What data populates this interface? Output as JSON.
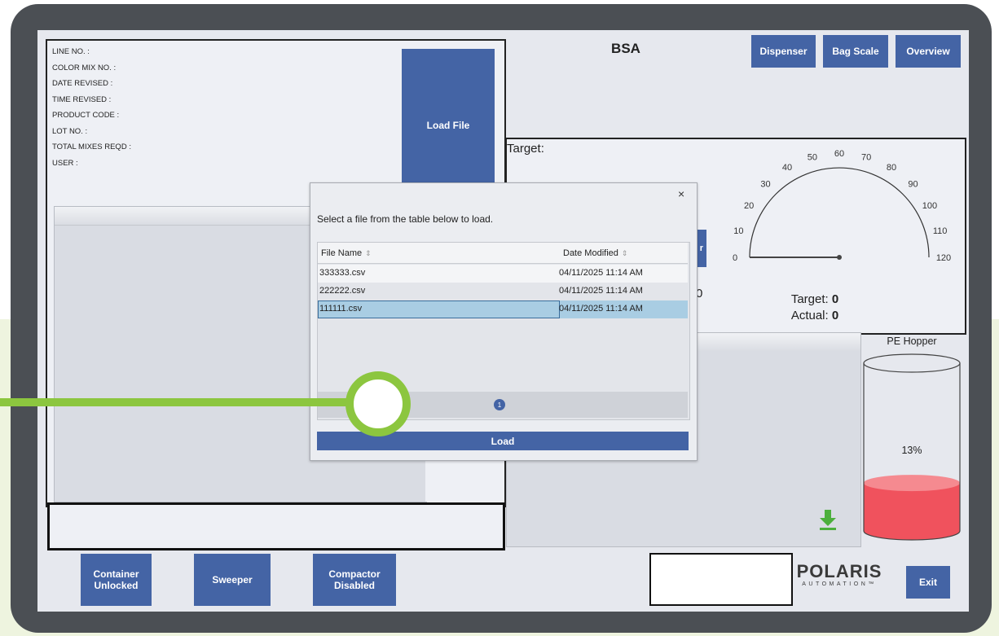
{
  "header": {
    "title": "BSA",
    "nav_buttons": [
      "Dispenser",
      "Bag Scale",
      "Overview"
    ]
  },
  "info_fields": [
    "LINE NO. :",
    "COLOR MIX NO. :",
    "DATE REVISED :",
    "TIME REVISED :",
    "PRODUCT CODE :",
    "LOT NO. :",
    "TOTAL MIXES REQD :",
    "USER :"
  ],
  "load_file_label": "Load File",
  "scale": {
    "target_label": "Target:",
    "gauge_ticks": [
      "0",
      "10",
      "20",
      "30",
      "40",
      "50",
      "60",
      "70",
      "80",
      "90",
      "100",
      "110",
      "120"
    ],
    "gauge_value": 0,
    "gauge_max": 120,
    "readout_target_label": "Target:",
    "readout_target_value": "0",
    "readout_actual_label": "Actual:",
    "readout_actual_value": "0",
    "partial_button_text": "r",
    "partial_value_text": "0"
  },
  "hopper": {
    "label": "PE Hopper",
    "percent_text": "13%",
    "fill_fraction": 0.13,
    "fill_color": "#f0525d"
  },
  "dialog": {
    "close_symbol": "×",
    "message": "Select a file from the table below to load.",
    "columns": [
      "File Name",
      "Date Modified"
    ],
    "rows": [
      {
        "file": "333333.csv",
        "date": "04/11/2025 11:14 AM"
      },
      {
        "file": "222222.csv",
        "date": "04/11/2025 11:14 AM"
      },
      {
        "file": "111111.csv",
        "date": "04/11/2025 11:14 AM"
      }
    ],
    "selected_row": 2,
    "page_number": "1",
    "load_label": "Load"
  },
  "bottom_buttons": [
    "Container\nUnlocked",
    "Sweeper",
    "Compactor\nDisabled"
  ],
  "logo": {
    "main": "POLARIS",
    "sub": "AUTOMATION™"
  },
  "exit_label": "Exit",
  "colors": {
    "button_blue": "#4464a5",
    "highlight_green": "#8cc63f",
    "selected_row": "#a9cde3",
    "download_green": "#4caf3c"
  }
}
